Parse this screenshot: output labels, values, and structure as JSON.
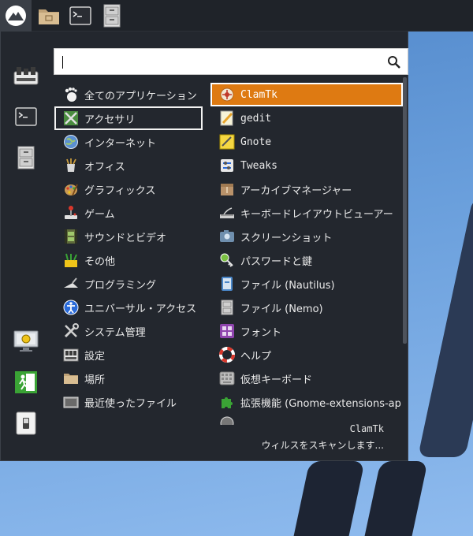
{
  "search": {
    "value": "",
    "placeholder": ""
  },
  "categories": [
    {
      "label": "全てのアプリケーション",
      "icon": "gnome-foot-icon"
    },
    {
      "label": "アクセサリ",
      "icon": "accessories-icon"
    },
    {
      "label": "インターネット",
      "icon": "globe-icon"
    },
    {
      "label": "オフィス",
      "icon": "office-icon"
    },
    {
      "label": "グラフィックス",
      "icon": "graphics-palette-icon"
    },
    {
      "label": "ゲーム",
      "icon": "joystick-icon"
    },
    {
      "label": "サウンドとビデオ",
      "icon": "film-strip-icon"
    },
    {
      "label": "その他",
      "icon": "other-apps-icon"
    },
    {
      "label": "プログラミング",
      "icon": "trowel-icon"
    },
    {
      "label": "ユニバーサル・アクセス",
      "icon": "accessibility-icon"
    },
    {
      "label": "システム管理",
      "icon": "tools-icon"
    },
    {
      "label": "設定",
      "icon": "settings-panel-icon"
    },
    {
      "label": "場所",
      "icon": "folder-icon"
    },
    {
      "label": "最近使ったファイル",
      "icon": "recent-files-icon"
    }
  ],
  "apps": [
    {
      "label": "ClamTk",
      "icon": "clamtk-icon"
    },
    {
      "label": "gedit",
      "icon": "gedit-icon"
    },
    {
      "label": "Gnote",
      "icon": "gnote-icon"
    },
    {
      "label": "Tweaks",
      "icon": "tweaks-icon"
    },
    {
      "label": "アーカイブマネージャー",
      "icon": "archive-icon"
    },
    {
      "label": "キーボードレイアウトビューアー",
      "icon": "keyboard-layout-icon"
    },
    {
      "label": "スクリーンショット",
      "icon": "screenshot-icon"
    },
    {
      "label": "パスワードと鍵",
      "icon": "key-icon"
    },
    {
      "label": "ファイル (Nautilus)",
      "icon": "nautilus-icon"
    },
    {
      "label": "ファイル (Nemo)",
      "icon": "nemo-icon"
    },
    {
      "label": "フォント",
      "icon": "font-icon"
    },
    {
      "label": "ヘルプ",
      "icon": "lifebuoy-icon"
    },
    {
      "label": "仮想キーボード",
      "icon": "virtual-keyboard-icon"
    },
    {
      "label": "拡張機能 (Gnome-extensions-app)",
      "icon": "puzzle-icon"
    }
  ],
  "footer": {
    "app_name": "ClamTk",
    "app_description": "ウィルスをスキャンします..."
  },
  "colors": {
    "selection": "#de7a12",
    "panel": "#1f2329",
    "menu_bg": "#23272e"
  }
}
